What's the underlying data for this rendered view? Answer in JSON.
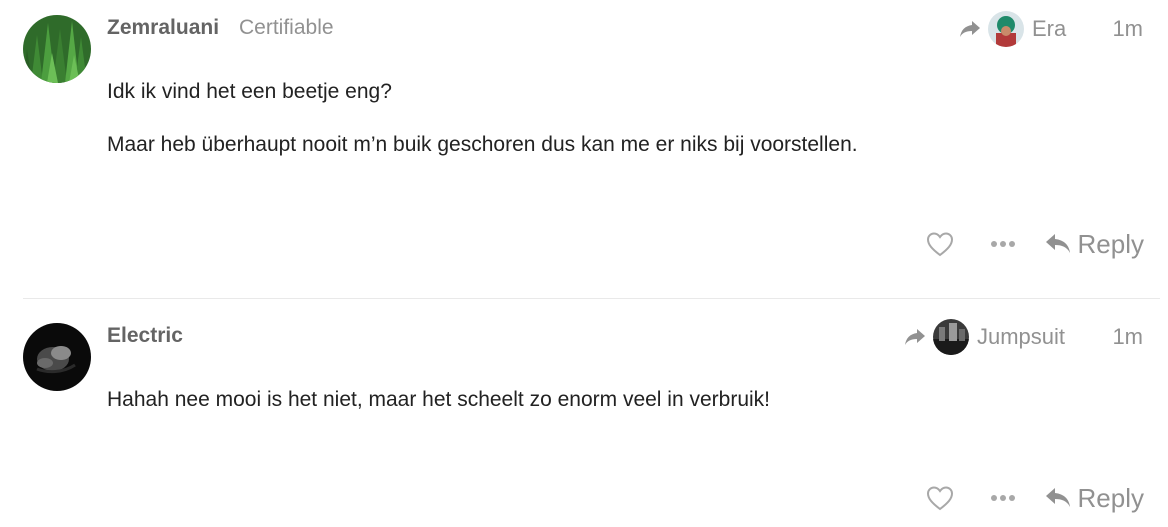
{
  "posts": [
    {
      "username": "Zemraluani",
      "user_title": "Certifiable",
      "reply_to_username": "Era",
      "date": "1m",
      "paragraphs": [
        "Idk ik vind het een beetje eng?",
        "Maar heb überhaupt nooit m’n buik geschoren dus kan me er niks bij voorstellen."
      ],
      "reply_label": "Reply"
    },
    {
      "username": "Electric",
      "user_title": "",
      "reply_to_username": "Jumpsuit",
      "date": "1m",
      "paragraphs": [
        "Hahah nee mooi is het niet, maar het scheelt zo enorm veel in verbruik!"
      ],
      "reply_label": "Reply"
    }
  ],
  "colors": {
    "muted": "#919191",
    "username": "#646464",
    "text": "#222222",
    "divider": "#e9e9e9"
  },
  "icons": {
    "share": "share-arrow-icon",
    "like": "heart-icon",
    "more": "ellipsis-icon",
    "reply": "reply-arrow-icon"
  }
}
